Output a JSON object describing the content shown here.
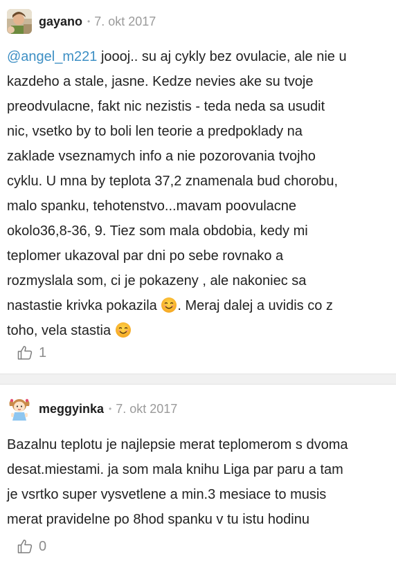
{
  "comments": [
    {
      "username": "gayano",
      "separator": "•",
      "date": "7. okt 2017",
      "mention": "@angel_m221",
      "lines": [
        " joooj.. su aj cykly bez ovulacie, ale nie u",
        "kazdeho a stale, jasne. Kedze nevies ake su tvoje",
        "preodvulacne, fakt nic nezistis - teda neda sa usudit",
        "nic, vsetko by to boli len teorie a predpoklady na",
        "zaklade vseznamych info a nie pozorovania tvojho",
        "cyklu. U mna by teplota 37,2 znamenala bud chorobu,",
        "malo spanku, tehotenstvo...mavam poovulacne",
        "okolo36,8-36, 9. Tiez som mala obdobia, kedy mi",
        "teplomer ukazoval par dni po sebe rovnako a",
        "rozmyslala som, ci je pokazeny , ale nakoniec sa",
        "nastastie krivka pokazila",
        ". Meraj dalej a uvidis co z",
        "toho, vela stastia"
      ],
      "likes": "1",
      "avatar_icon": "photo-avatar",
      "like_icon": "thumbs-up-icon",
      "emoji_icon": "smiling-face-emoji"
    },
    {
      "username": "meggyinka",
      "separator": "•",
      "date": "7. okt 2017",
      "lines": [
        "Bazalnu teplotu je najlepsie merat teplomerom s dvoma",
        "desat.miestami. ja som mala knihu Liga par paru a tam",
        "je vsrtko super vysvetlene a min.3 mesiace to musis",
        "merat pravidelne po 8hod spanku v tu istu hodinu"
      ],
      "likes": "0",
      "avatar_icon": "girl-cartoon-avatar",
      "like_icon": "thumbs-up-icon"
    }
  ],
  "colors": {
    "mention": "#3d8fc4",
    "text": "#222222",
    "meta": "#9a9a9a",
    "divider": "#f1f1f1"
  }
}
